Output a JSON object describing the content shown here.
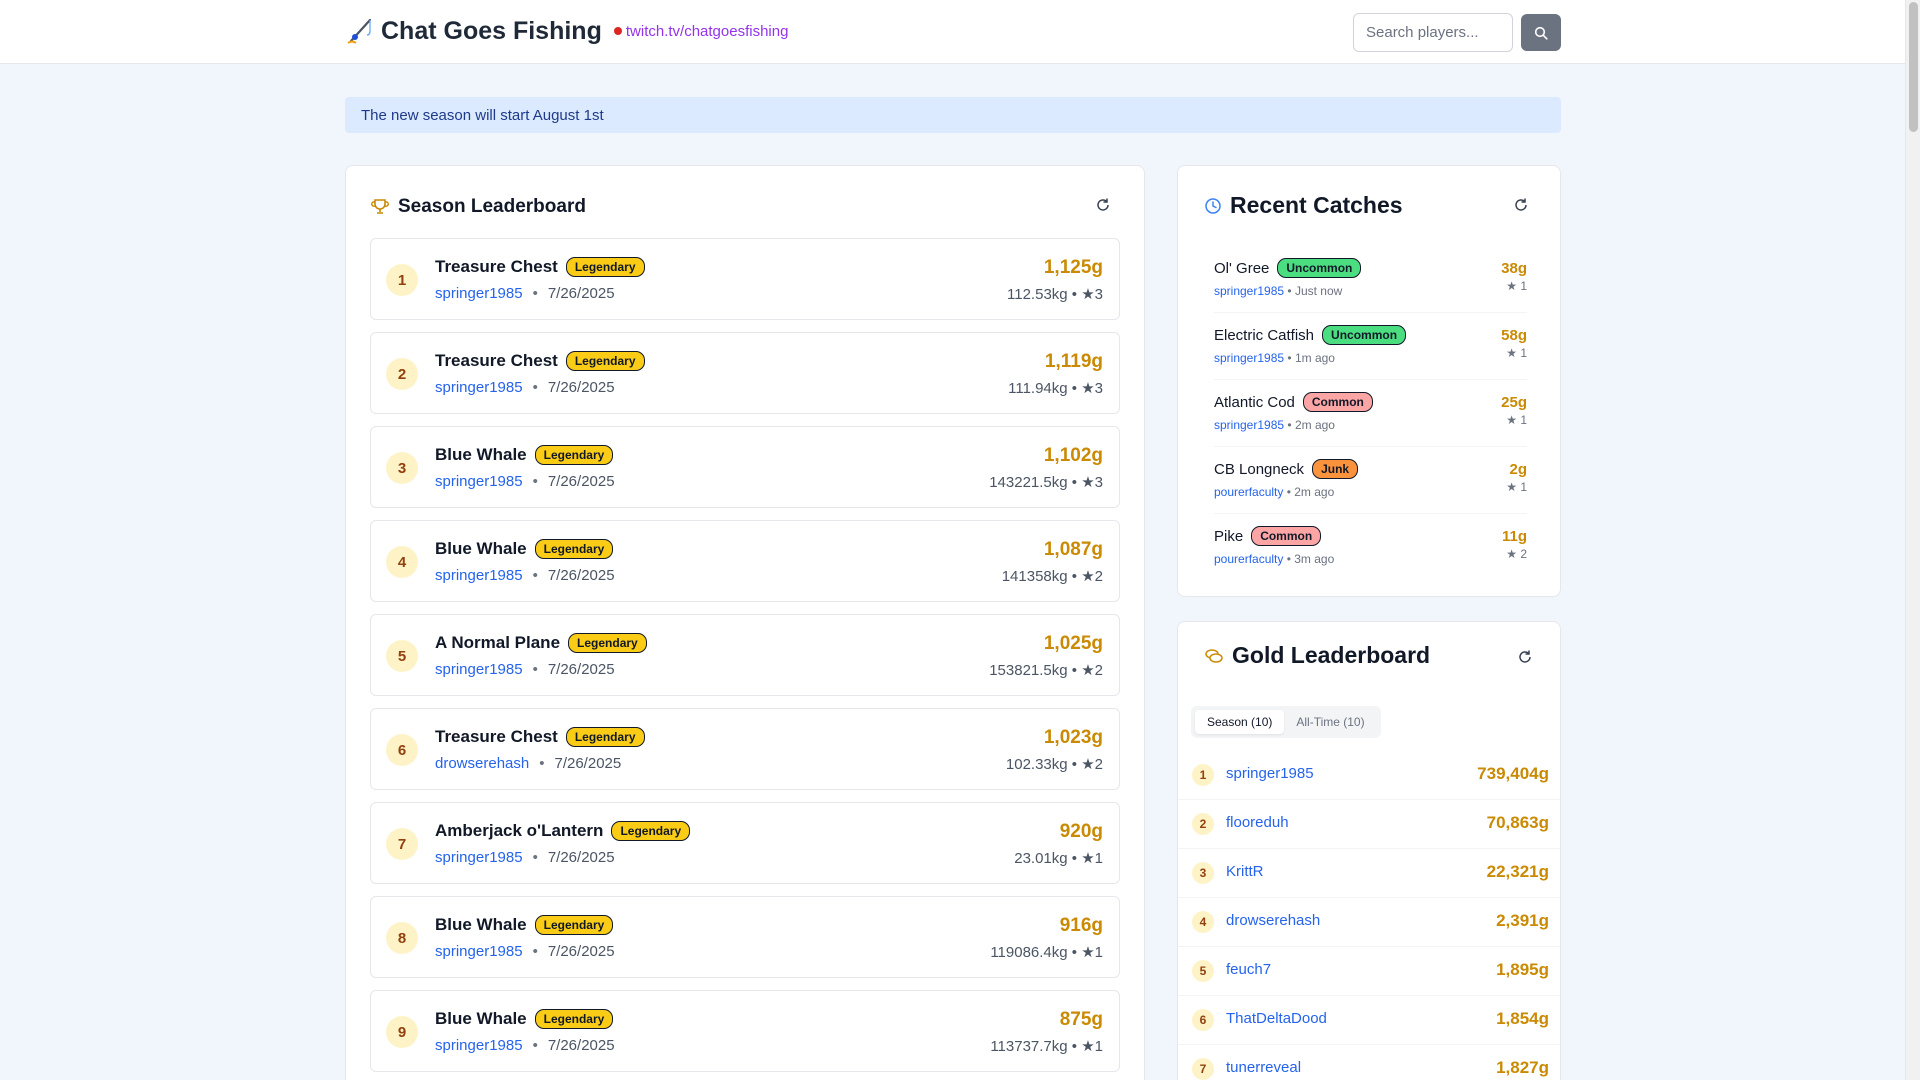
{
  "header": {
    "title": "Chat Goes Fishing",
    "live_link": "twitch.tv/chatgoesfishing",
    "search_placeholder": "Search players...",
    "icons": {
      "brand": "fishing-rod-icon",
      "search": "search-icon"
    }
  },
  "announcement": "The new season will start August 1st",
  "season_leaderboard": {
    "title": "Season Leaderboard",
    "entries": [
      {
        "rank": "1",
        "fish": "Treasure Chest",
        "rarity": "Legendary",
        "user": "springer1985",
        "date": "7/26/2025",
        "gold": "1,125g",
        "detail": "112.53kg • ★3"
      },
      {
        "rank": "2",
        "fish": "Treasure Chest",
        "rarity": "Legendary",
        "user": "springer1985",
        "date": "7/26/2025",
        "gold": "1,119g",
        "detail": "111.94kg • ★3"
      },
      {
        "rank": "3",
        "fish": "Blue Whale",
        "rarity": "Legendary",
        "user": "springer1985",
        "date": "7/26/2025",
        "gold": "1,102g",
        "detail": "143221.5kg • ★3"
      },
      {
        "rank": "4",
        "fish": "Blue Whale",
        "rarity": "Legendary",
        "user": "springer1985",
        "date": "7/26/2025",
        "gold": "1,087g",
        "detail": "141358kg • ★2"
      },
      {
        "rank": "5",
        "fish": "A Normal Plane",
        "rarity": "Legendary",
        "user": "springer1985",
        "date": "7/26/2025",
        "gold": "1,025g",
        "detail": "153821.5kg • ★2"
      },
      {
        "rank": "6",
        "fish": "Treasure Chest",
        "rarity": "Legendary",
        "user": "drowserehash",
        "date": "7/26/2025",
        "gold": "1,023g",
        "detail": "102.33kg • ★2"
      },
      {
        "rank": "7",
        "fish": "Amberjack o'Lantern",
        "rarity": "Legendary",
        "user": "springer1985",
        "date": "7/26/2025",
        "gold": "920g",
        "detail": "23.01kg • ★1"
      },
      {
        "rank": "8",
        "fish": "Blue Whale",
        "rarity": "Legendary",
        "user": "springer1985",
        "date": "7/26/2025",
        "gold": "916g",
        "detail": "119086.4kg • ★1"
      },
      {
        "rank": "9",
        "fish": "Blue Whale",
        "rarity": "Legendary",
        "user": "springer1985",
        "date": "7/26/2025",
        "gold": "875g",
        "detail": "113737.7kg • ★1"
      }
    ]
  },
  "recent_catches": {
    "title": "Recent Catches",
    "items": [
      {
        "fish": "Ol' Gree",
        "rarity": "Uncommon",
        "user": "springer1985",
        "time": "Just now",
        "gold": "38g",
        "stars": "★ 1"
      },
      {
        "fish": "Electric Catfish",
        "rarity": "Uncommon",
        "user": "springer1985",
        "time": "1m ago",
        "gold": "58g",
        "stars": "★ 1"
      },
      {
        "fish": "Atlantic Cod",
        "rarity": "Common",
        "user": "springer1985",
        "time": "2m ago",
        "gold": "25g",
        "stars": "★ 1"
      },
      {
        "fish": "CB Longneck",
        "rarity": "Junk",
        "user": "pourerfaculty",
        "time": "2m ago",
        "gold": "2g",
        "stars": "★ 1"
      },
      {
        "fish": "Pike",
        "rarity": "Common",
        "user": "pourerfaculty",
        "time": "3m ago",
        "gold": "11g",
        "stars": "★ 2"
      }
    ]
  },
  "gold_leaderboard": {
    "title": "Gold Leaderboard",
    "tabs": [
      {
        "label": "Season (10)",
        "active": true
      },
      {
        "label": "All-Time (10)",
        "active": false
      }
    ],
    "rows": [
      {
        "rank": "1",
        "user": "springer1985",
        "gold": "739,404g"
      },
      {
        "rank": "2",
        "user": "flooreduh",
        "gold": "70,863g"
      },
      {
        "rank": "3",
        "user": "KrittR",
        "gold": "22,321g"
      },
      {
        "rank": "4",
        "user": "drowserehash",
        "gold": "2,391g"
      },
      {
        "rank": "5",
        "user": "feuch7",
        "gold": "1,895g"
      },
      {
        "rank": "6",
        "user": "ThatDeltaDood",
        "gold": "1,854g"
      },
      {
        "rank": "7",
        "user": "tunerreveal",
        "gold": "1,827g"
      }
    ]
  },
  "colors": {
    "accent_gold": "#ca8a04",
    "link_blue": "#2563eb",
    "legendary": "#facc15",
    "uncommon": "#4ade80",
    "common": "#fca5a5",
    "junk": "#fb923c",
    "live_dot": "#dc2626"
  }
}
